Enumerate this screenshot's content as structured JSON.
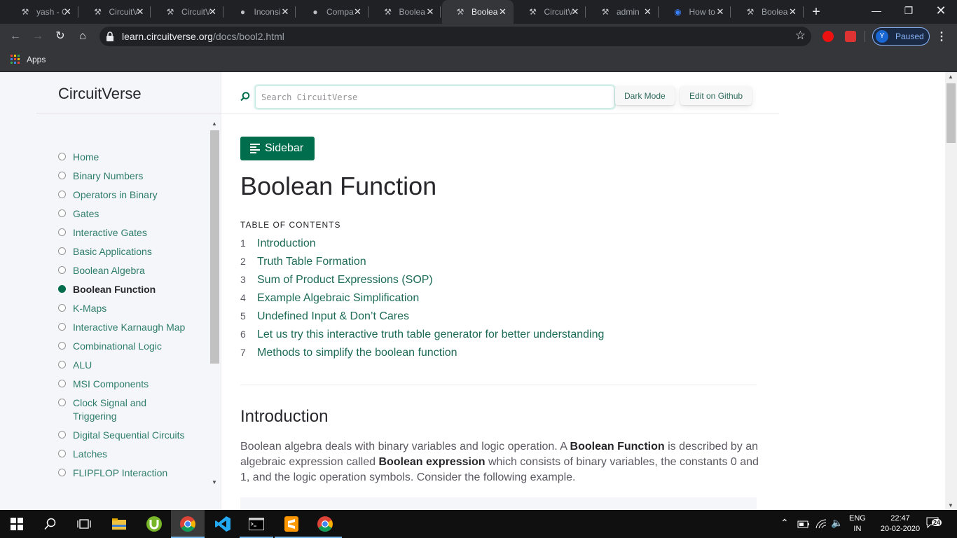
{
  "browser": {
    "tabs": [
      {
        "title": "yash - C",
        "icon": "circuitverse-icon",
        "active": false
      },
      {
        "title": "CircuitV",
        "icon": "circuitverse-icon",
        "active": false
      },
      {
        "title": "CircuitV",
        "icon": "circuitverse-icon",
        "active": false
      },
      {
        "title": "Inconsi",
        "icon": "github-icon",
        "active": false
      },
      {
        "title": "Compa",
        "icon": "github-icon",
        "active": false
      },
      {
        "title": "Boolea",
        "icon": "circuitverse-icon",
        "active": false
      },
      {
        "title": "Boolea",
        "icon": "circuitverse-icon",
        "active": true
      },
      {
        "title": "CircuitV",
        "icon": "circuitverse-icon",
        "active": false
      },
      {
        "title": "admin",
        "icon": "circuitverse-icon",
        "active": false
      },
      {
        "title": "How to",
        "icon": "ionic-icon",
        "active": false
      },
      {
        "title": "Boolea",
        "icon": "circuitverse-icon",
        "active": false
      }
    ],
    "url_host": "learn.circuitverse.org",
    "url_path": "/docs/bool2.html",
    "profile_initial": "Y",
    "profile_status": "Paused",
    "bookmarks_apps": "Apps"
  },
  "site": {
    "brand": "CircuitVerse",
    "search_placeholder": "Search CircuitVerse",
    "dark_mode": "Dark Mode",
    "edit_github": "Edit on Github",
    "sidebar_button": "Sidebar"
  },
  "nav": [
    {
      "label": "Home",
      "current": false
    },
    {
      "label": "Binary Numbers",
      "current": false
    },
    {
      "label": "Operators in Binary",
      "current": false
    },
    {
      "label": "Gates",
      "current": false
    },
    {
      "label": "Interactive Gates",
      "current": false
    },
    {
      "label": "Basic Applications",
      "current": false
    },
    {
      "label": "Boolean Algebra",
      "current": false
    },
    {
      "label": "Boolean Function",
      "current": true
    },
    {
      "label": "K-Maps",
      "current": false
    },
    {
      "label": "Interactive Karnaugh Map",
      "current": false
    },
    {
      "label": "Combinational Logic",
      "current": false
    },
    {
      "label": "ALU",
      "current": false
    },
    {
      "label": "MSI Components",
      "current": false
    },
    {
      "label": "Clock Signal and Triggering",
      "current": false
    },
    {
      "label": "Digital Sequential Circuits",
      "current": false
    },
    {
      "label": "Latches",
      "current": false
    },
    {
      "label": "FLIPFLOP Interaction",
      "current": false
    }
  ],
  "content": {
    "title": "Boolean Function",
    "toc_heading": "TABLE OF CONTENTS",
    "toc": [
      {
        "num": "1",
        "label": "Introduction"
      },
      {
        "num": "2",
        "label": "Truth Table Formation"
      },
      {
        "num": "3",
        "label": "Sum of Product Expressions (SOP)"
      },
      {
        "num": "4",
        "label": "Example Algebraic Simplification"
      },
      {
        "num": "5",
        "label": "Undefined Input & Don’t Cares"
      },
      {
        "num": "6",
        "label": "Let us try this interactive truth table generator for better understanding"
      },
      {
        "num": "7",
        "label": "Methods to simplify the boolean function"
      }
    ],
    "section_title": "Introduction",
    "para_1": "Boolean algebra deals with binary variables and logic operation. A ",
    "para_bold_1": "Boolean Function",
    "para_2": " is described by an algebraic expression called ",
    "para_bold_2": "Boolean expression",
    "para_3": " which consists of binary variables, the constants 0 and 1, and the logic operation symbols. Consider the following example."
  },
  "taskbar": {
    "lang_top": "ENG",
    "lang_bottom": "IN",
    "time": "22:47",
    "date": "20-02-2020",
    "notifications": "24"
  },
  "colors": {
    "accent": "#006d4c",
    "link": "#1d6b57",
    "chrome_dark": "#202124",
    "chrome_toolbar": "#35363a"
  }
}
